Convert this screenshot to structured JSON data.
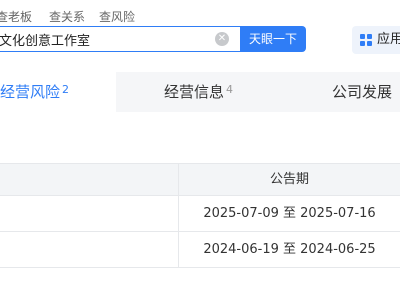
{
  "search": {
    "tabs": [
      "查老板",
      "查关系",
      "查风险"
    ],
    "query": "文化创意工作室",
    "button_label": "天眼一下",
    "app_label": "应用"
  },
  "category_tabs": [
    {
      "label": "经营风险",
      "count": "2"
    },
    {
      "label": "经营信息",
      "count": "4"
    },
    {
      "label": "公司发展"
    }
  ],
  "table": {
    "header": "公告期",
    "rows": [
      "2025-07-09 至 2025-07-16",
      "2024-06-19 至 2024-06-25"
    ]
  },
  "colors": {
    "accent": "#2f7df6",
    "tab_bar_bg": "#f5f6f8",
    "table_header_bg": "#f3f5f7"
  },
  "icons": [
    "clear-icon",
    "app-grid-icon"
  ]
}
